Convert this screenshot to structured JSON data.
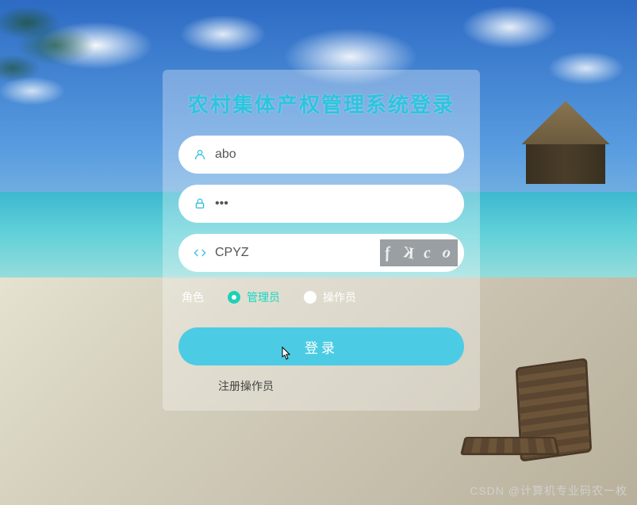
{
  "title": "农村集体产权管理系统登录",
  "username": {
    "value": "abo",
    "placeholder": ""
  },
  "password": {
    "value": "•••",
    "placeholder": ""
  },
  "captcha": {
    "value": "CPYZ",
    "image_text": "fKco"
  },
  "role": {
    "label": "角色",
    "options": [
      {
        "label": "管理员",
        "checked": true
      },
      {
        "label": "操作员",
        "checked": false
      }
    ]
  },
  "buttons": {
    "login": "登录"
  },
  "links": {
    "register": "注册操作员"
  },
  "watermark": "CSDN @计算机专业码农一枚"
}
